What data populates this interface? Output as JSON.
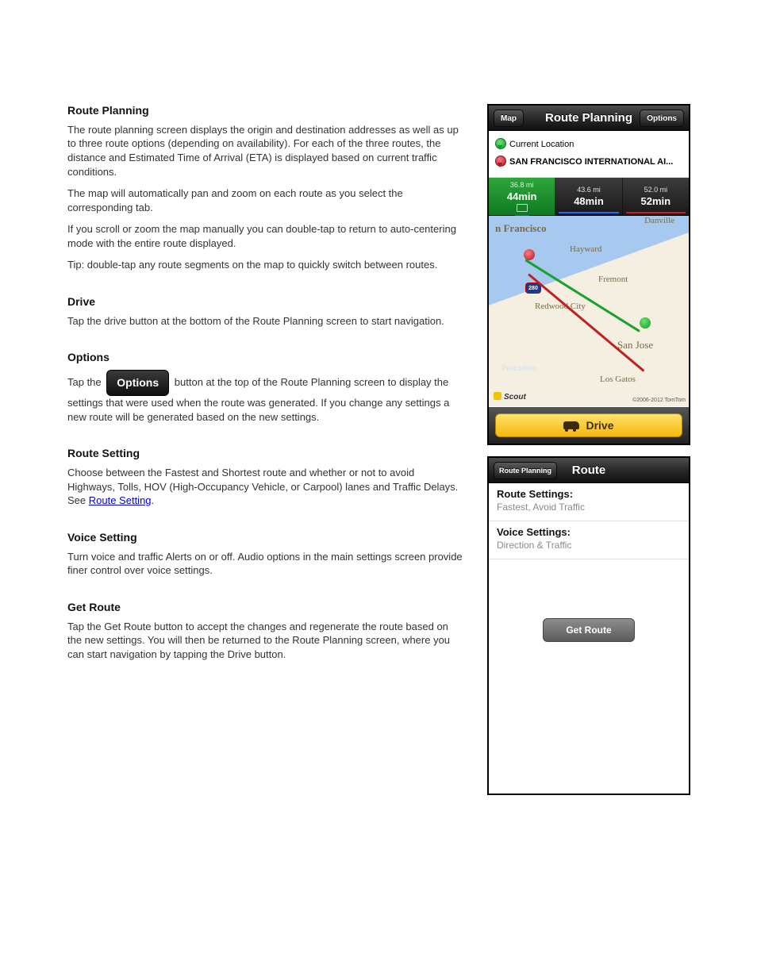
{
  "text": {
    "route_planning_head": "Route Planning",
    "route_planning_intro": "The route planning screen displays the origin and destination addresses as well as up to three route options (depending on availability). For each of the three routes, the distance and Estimated Time of Arrival (ETA) is displayed based on current traffic conditions.",
    "centering1": "The map will automatically pan and zoom on each route as you select the corresponding tab.",
    "centering2": "If you scroll or zoom the map manually you can double-tap to return to auto-centering mode with the entire route displayed.",
    "tip": "Tip: double-tap any route segments on the map to quickly switch between routes.",
    "drive_head": "Drive",
    "drive_para": "Tap the drive button at the bottom of the Route Planning screen to start navigation.",
    "options_head": "Options",
    "options_para_pre": "Tap the ",
    "options_para_post": " button at the top of the Route Planning screen to display the settings that were used when the route was generated. If you change any settings a new route will be generated based on the new settings.",
    "options_badge": "Options",
    "route_setting_head": "Route Setting",
    "route_setting_para": "Choose between the Fastest and Shortest route and whether or not to avoid Highways, Tolls, HOV (High-Occupancy Vehicle, or Carpool) lanes and Traffic Delays. See ",
    "route_setting_link": "Route Setting",
    "route_setting_close": ".",
    "voice_head": "Voice Setting",
    "voice_para": "Turn voice and traffic Alerts on or off. Audio options in the main settings screen provide finer control over voice settings.",
    "getroute_head": "Get Route",
    "getroute_para": "Tap the Get Route button to accept the changes and regenerate the route based on the new settings. You will then be returned to the Route Planning screen, where you can start navigation by tapping the Drive button."
  },
  "rp": {
    "nav_left": "Map",
    "nav_title": "Route Planning",
    "nav_right": "Options",
    "origin": "Current Location",
    "destination": "SAN FRANCISCO INTERNATIONAL AI...",
    "tabs": [
      {
        "dist": "36.8 mi",
        "time": "44min"
      },
      {
        "dist": "43.6 mi",
        "time": "48min"
      },
      {
        "dist": "52.0 mi",
        "time": "52min"
      }
    ],
    "map_labels": {
      "danville": "Danville",
      "sf": "n Francisco",
      "hayward": "Hayward",
      "fremont": "Fremont",
      "redwood": "Redwood City",
      "sanjose": "San Jose",
      "losgatos": "Los Gatos",
      "pescadero": "Pescadero",
      "shield": "280"
    },
    "scout": "Scout",
    "copyright": "©2006-2012 TomTom",
    "drive_label": "Drive"
  },
  "ro": {
    "nav_left": "Route Planning",
    "nav_title": "Route",
    "rows": [
      {
        "label": "Route Settings:",
        "value": "Fastest, Avoid Traffic"
      },
      {
        "label": "Voice Settings:",
        "value": "Direction & Traffic"
      }
    ],
    "getroute": "Get Route"
  }
}
